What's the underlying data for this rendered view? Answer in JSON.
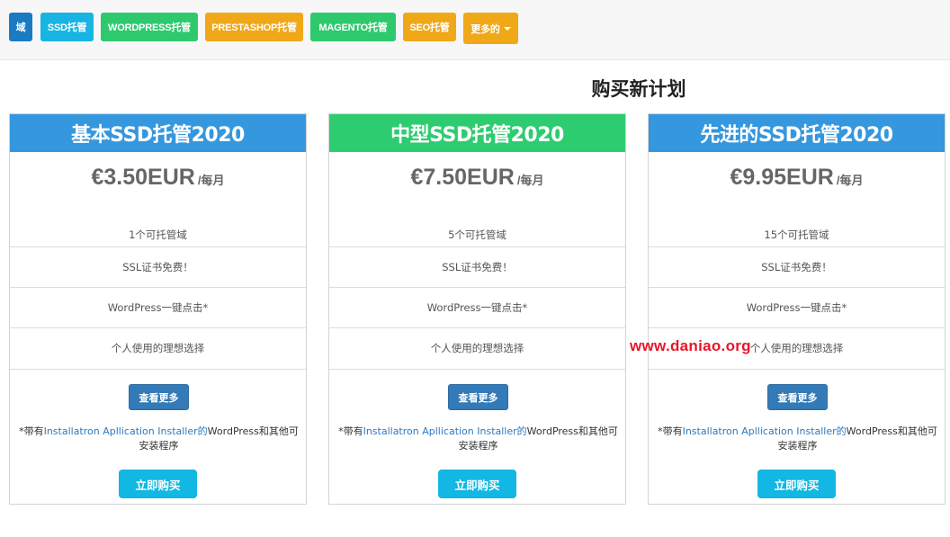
{
  "nav": {
    "tabs": [
      {
        "label": "域",
        "color": "#1a7bc3"
      },
      {
        "label": "SSD托管",
        "color": "#18b4e2"
      },
      {
        "label": "WORDPRESS托管",
        "color": "#2ec96d"
      },
      {
        "label": "PRESTASHOP托管",
        "color": "#f0a818"
      },
      {
        "label": "MAGENTO托管",
        "color": "#2ec96d"
      },
      {
        "label": "SEO托管",
        "color": "#f0a818"
      },
      {
        "label": "更多的",
        "color": "#f0a818"
      }
    ]
  },
  "page": {
    "title": "购买新计划"
  },
  "plans": [
    {
      "name": "基本SSD托管2020",
      "header_color": "#3597dd",
      "price": "€3.50EUR",
      "period": "/每月",
      "features": [
        "1个可托管域",
        "SSL证书免费！",
        "WordPress一键点击*",
        "个人使用的理想选择"
      ],
      "more_label": "查看更多",
      "note_prefix": "*带有",
      "note_link": "Installatron Apllication Installer的",
      "note_suffix": "WordPress和其他可安装程序",
      "buy_label": "立即购买"
    },
    {
      "name": "中型SSD托管2020",
      "header_color": "#2ecc70",
      "price": "€7.50EUR",
      "period": "/每月",
      "features": [
        "5个可托管域",
        "SSL证书免费！",
        "WordPress一键点击*",
        "个人使用的理想选择"
      ],
      "more_label": "查看更多",
      "note_prefix": "*带有",
      "note_link": "Installatron Apllication Installer的",
      "note_suffix": "WordPress和其他可安装程序",
      "buy_label": "立即购买"
    },
    {
      "name": "先进的SSD托管2020",
      "header_color": "#3597dd",
      "price": "€9.95EUR",
      "period": "/每月",
      "features": [
        "15个可托管域",
        "SSL证书免费！",
        "WordPress一键点击*",
        "个人使用的理想选择"
      ],
      "more_label": "查看更多",
      "note_prefix": "*带有",
      "note_link": "Installatron Apllication Installer的",
      "note_suffix": "WordPress和其他可安装程序",
      "buy_label": "立即购买"
    }
  ],
  "watermark": "www.daniao.org"
}
